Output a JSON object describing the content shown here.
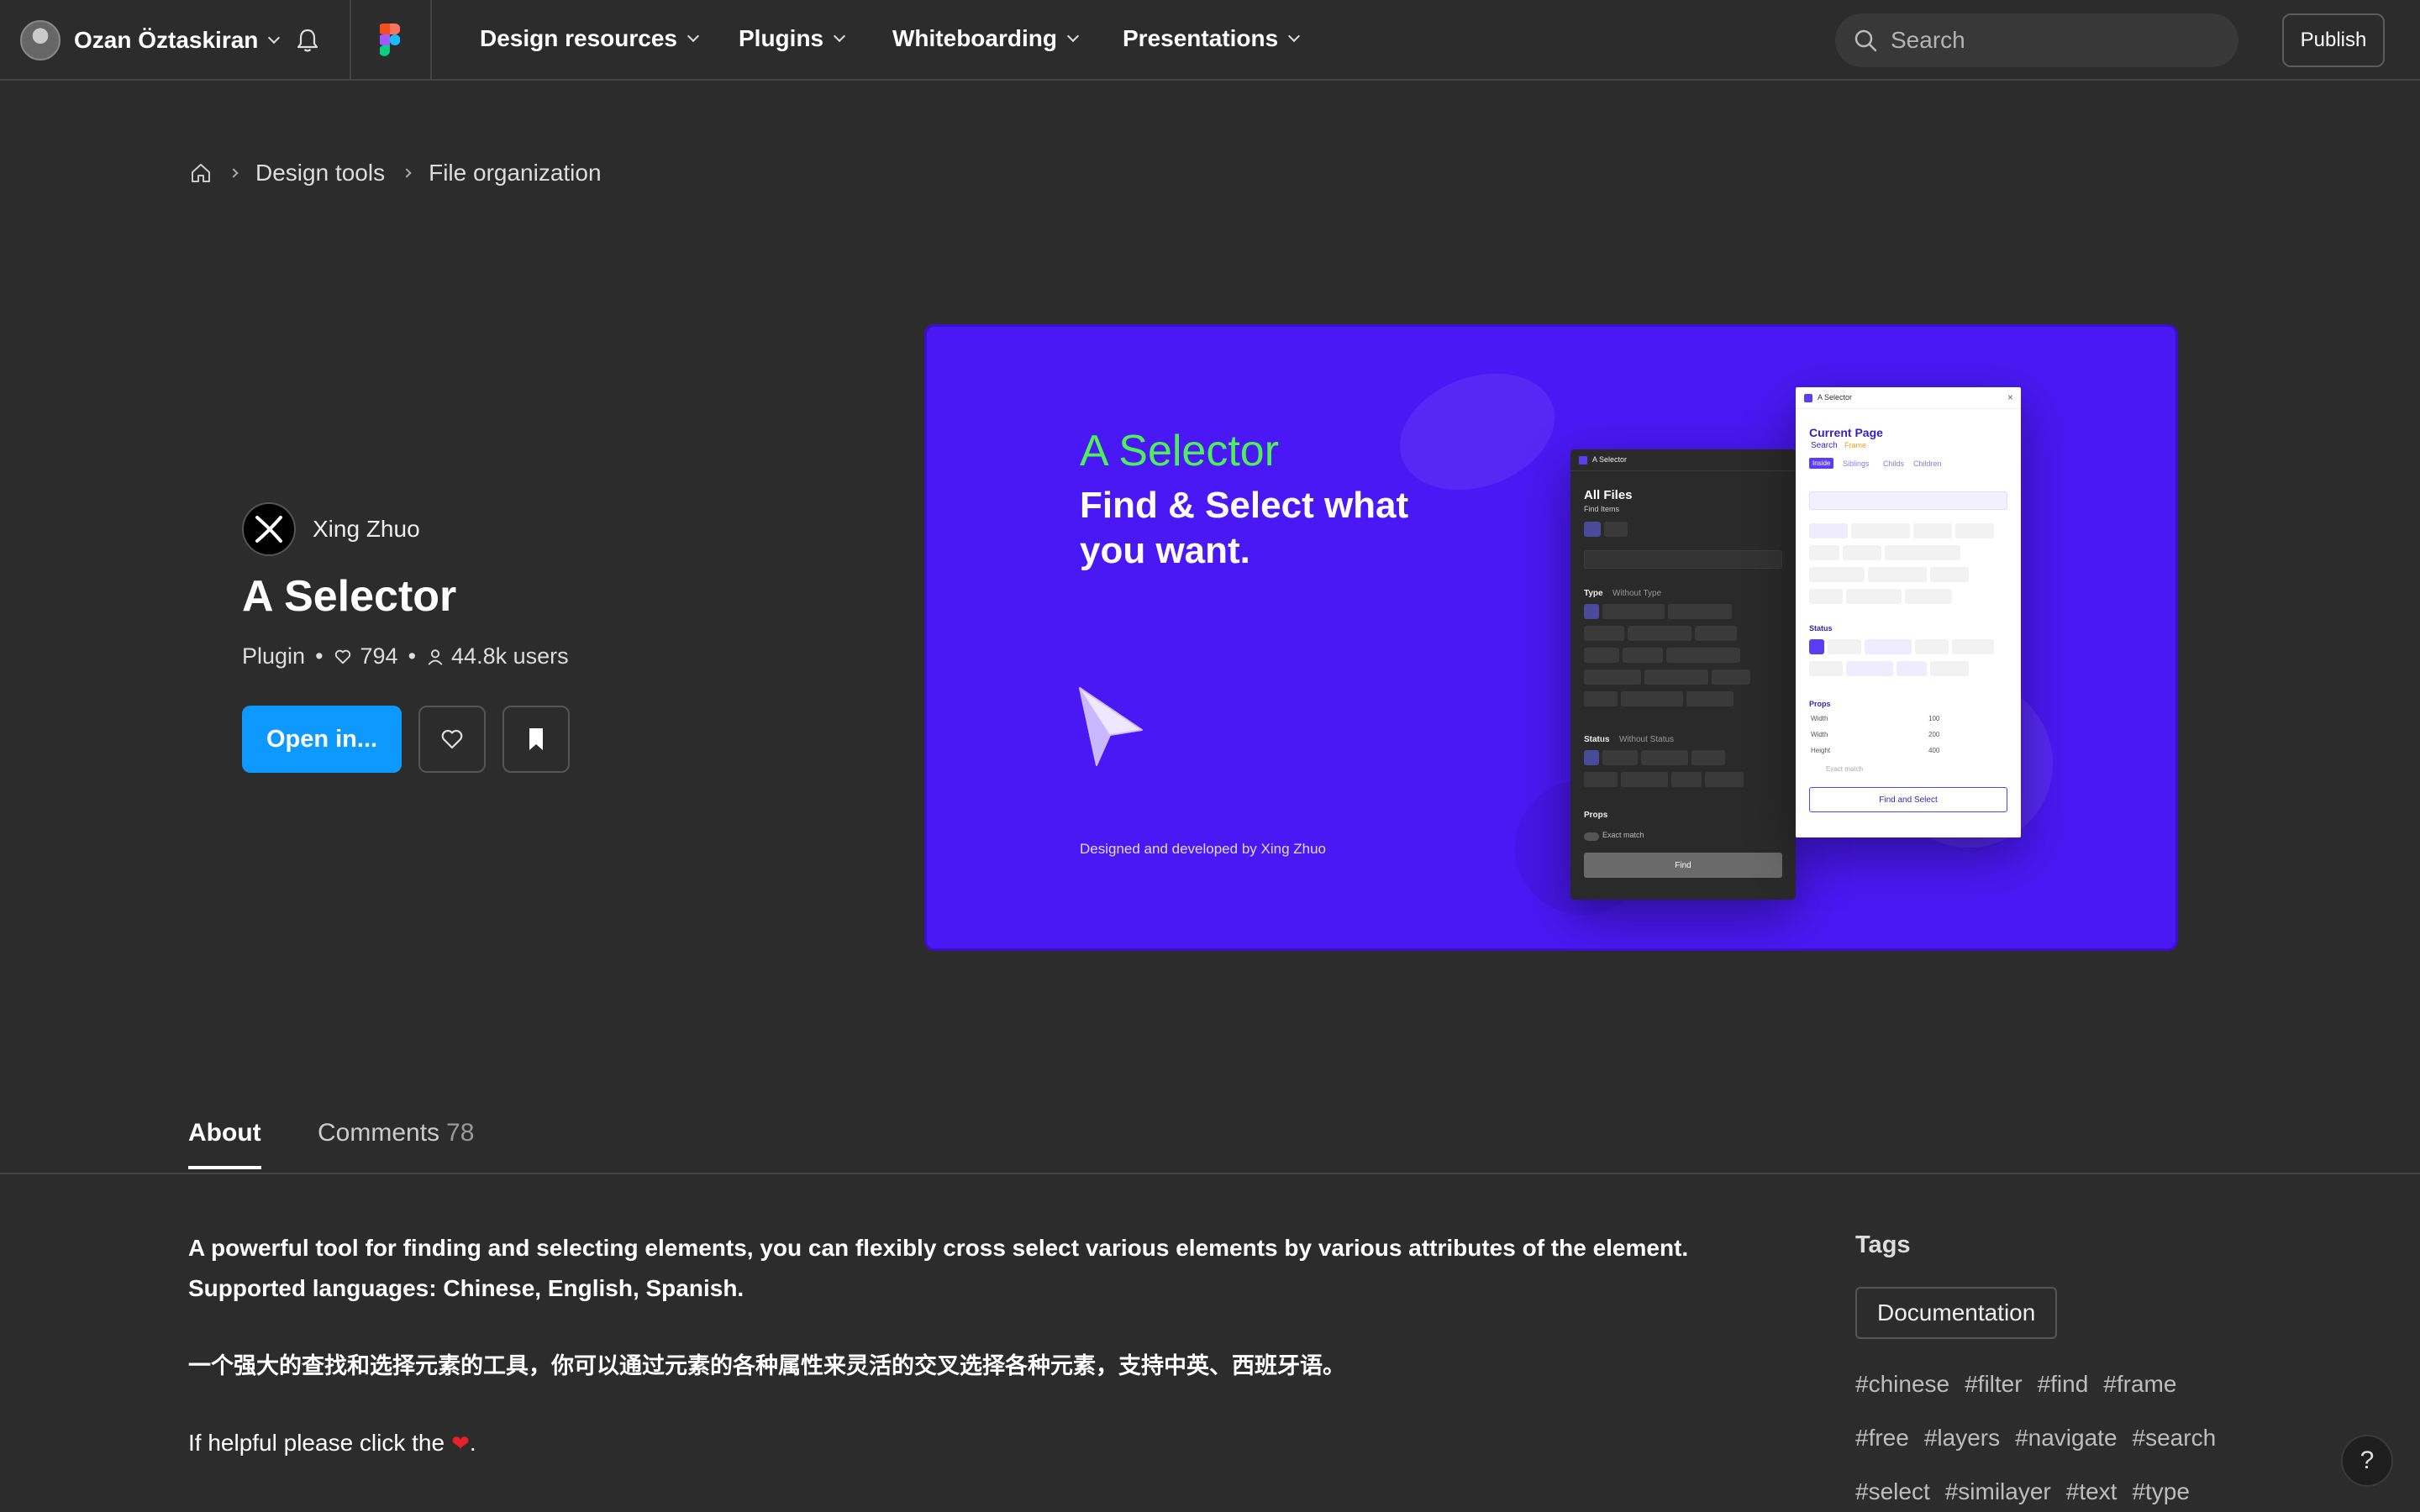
{
  "nav": {
    "user_name": "Ozan Öztaskiran",
    "items": [
      "Design resources",
      "Plugins",
      "Whiteboarding",
      "Presentations"
    ],
    "search_placeholder": "Search",
    "publish_label": "Publish"
  },
  "breadcrumb": [
    "Design tools",
    "File organization"
  ],
  "plugin": {
    "author": "Xing Zhuo",
    "title": "A Selector",
    "type": "Plugin",
    "likes": "794",
    "users": "44.8k users",
    "open_label": "Open in..."
  },
  "banner": {
    "title": "A Selector",
    "subtitle": "Find & Select what you want.",
    "credit": "Designed and developed by Xing Zhuo",
    "dark_panel": {
      "header": "A Selector",
      "section": "All Files",
      "find_items": "Find Items",
      "type_label": "Type",
      "type_none": "Without Type",
      "status_label": "Status",
      "status_none": "Without Status",
      "props_label": "Props",
      "exact_match": "Exact match",
      "find_btn": "Find"
    },
    "light_panel": {
      "header": "A Selector",
      "section": "Current Page",
      "search": "Search",
      "frame": "Frame",
      "tabs": [
        "Inside",
        "Siblings",
        "Childs",
        "Children"
      ],
      "status_label": "Status",
      "props_label": "Props",
      "props": [
        {
          "name": "Width",
          "value": "100"
        },
        {
          "name": "Width",
          "value": "200"
        },
        {
          "name": "Height",
          "value": "400"
        }
      ],
      "exact_match": "Exact match",
      "find_btn": "Find and Select"
    }
  },
  "tabs": {
    "about": "About",
    "comments": "Comments",
    "comments_count": "78"
  },
  "about": {
    "desc_en": "A powerful tool for finding and selecting elements, you can flexibly cross select various elements by various attributes of the element. Supported languages: Chinese, English, Spanish.",
    "desc_cn": "一个强大的查找和选择元素的工具，你可以通过元素的各种属性来灵活的交叉选择各种元素，支持中英、西班牙语。",
    "desc_help": "If helpful please click the",
    "desc_help_end": "."
  },
  "tags": {
    "title": "Tags",
    "category": "Documentation",
    "row1": [
      "#chinese",
      "#filter",
      "#find",
      "#frame"
    ],
    "row2": [
      "#free",
      "#layers",
      "#navigate",
      "#search"
    ],
    "row3": [
      "#select",
      "#similayer",
      "#text",
      "#type"
    ]
  },
  "help_label": "?",
  "colors": {
    "accent": "#0d99ff",
    "banner_bg": "#4a18f5",
    "banner_title": "#4ef05a"
  },
  "icons": [
    "bell-icon",
    "figma-logo",
    "search-icon",
    "home-icon",
    "heart-icon",
    "user-icon",
    "bookmark-icon",
    "cursor-icon"
  ]
}
